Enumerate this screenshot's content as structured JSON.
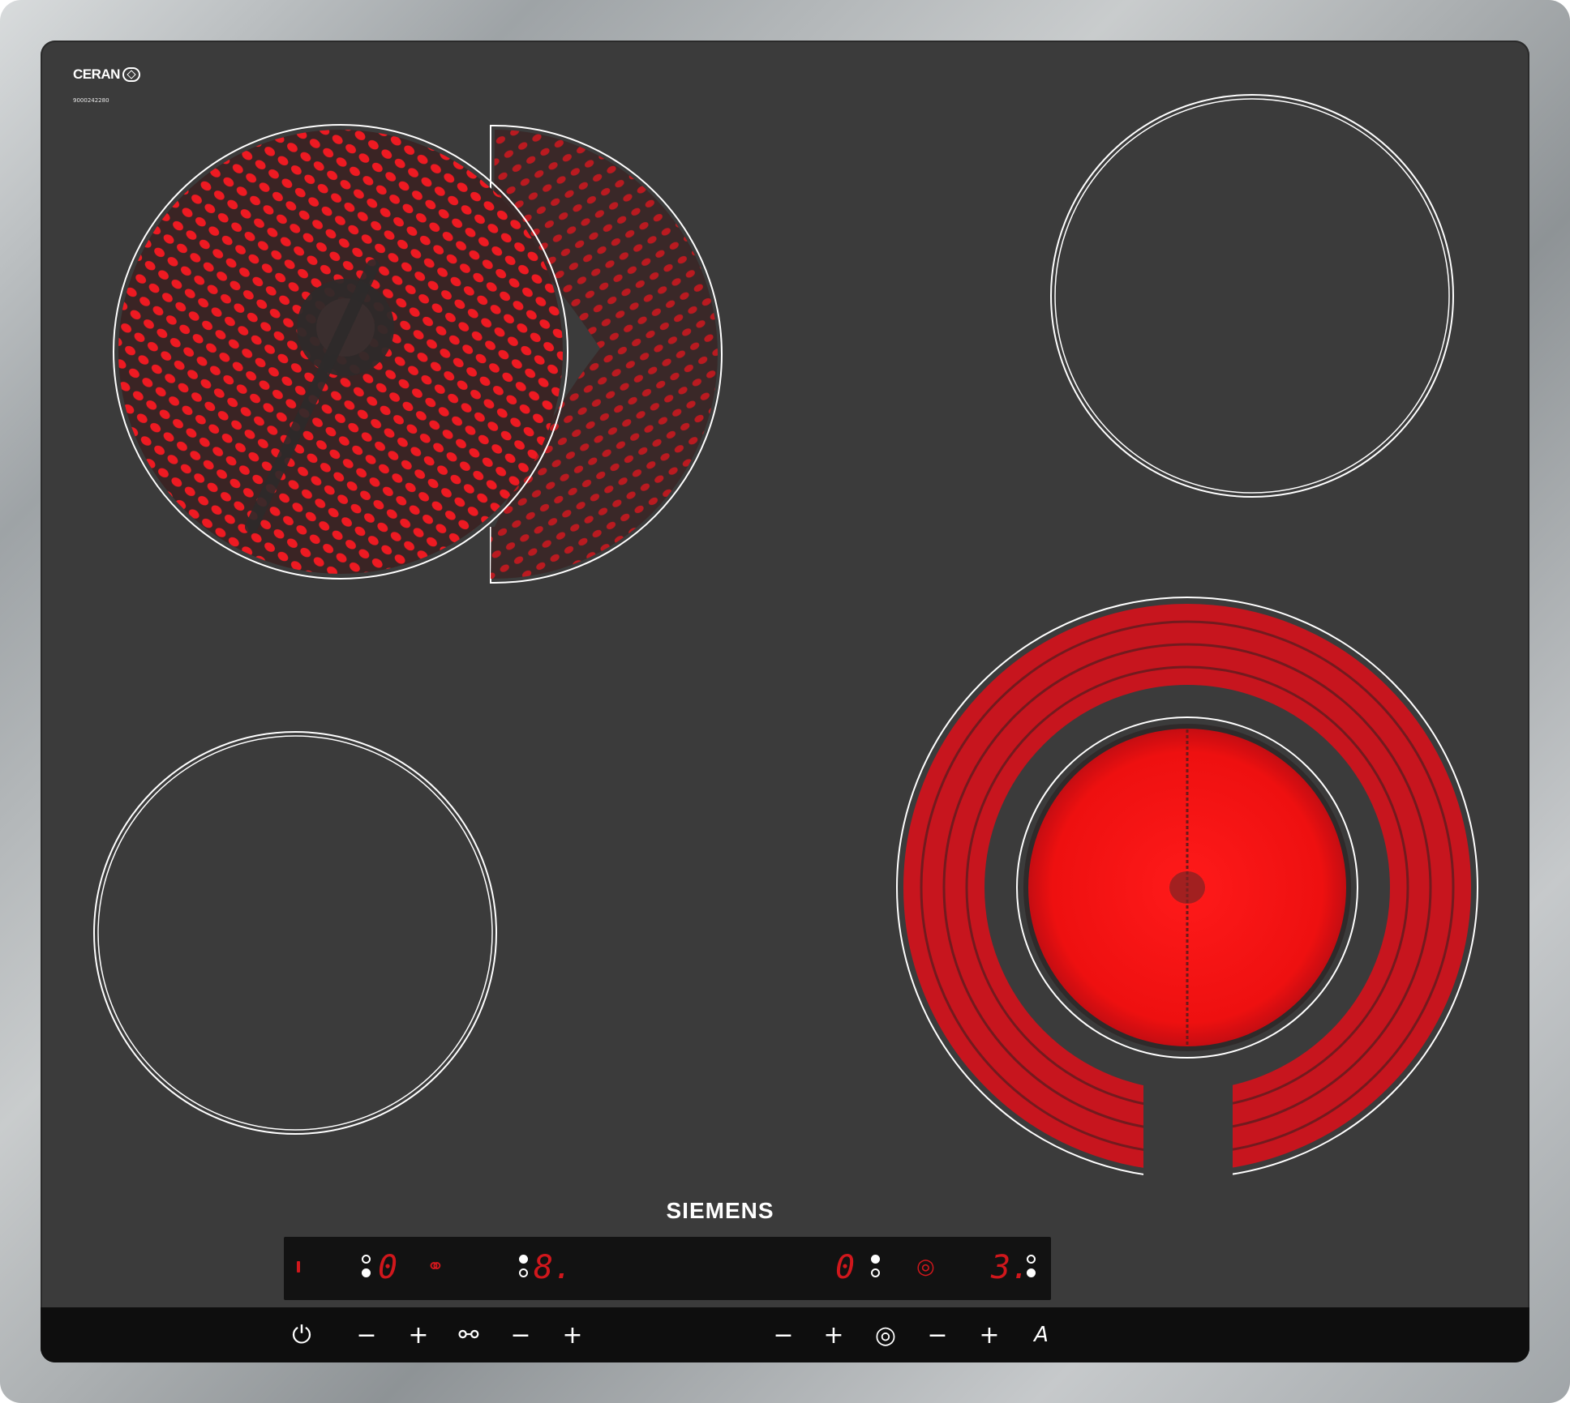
{
  "hob": {
    "certification_mark": "CERAN",
    "serial_number": "9000242280",
    "brand": "SIEMENS",
    "colors": {
      "glass": "#3b3b3b",
      "heat": "#e00f1a",
      "display_digits": "#d0171c"
    },
    "zones": [
      {
        "name": "front-left-extended",
        "state": "on"
      },
      {
        "name": "back-right",
        "state": "off"
      },
      {
        "name": "back-left",
        "state": "off"
      },
      {
        "name": "front-right-dual",
        "state": "on"
      }
    ]
  },
  "display": {
    "zone1_level": "0",
    "zone2_level": "8.",
    "zone3_level": "0",
    "zone4_level": "3."
  },
  "controls": {
    "minus": "−",
    "plus": "+",
    "a_label": "A",
    "icons": [
      "power-icon",
      "extended-zone-icon",
      "dual-zone-icon",
      "auto-icon"
    ]
  }
}
